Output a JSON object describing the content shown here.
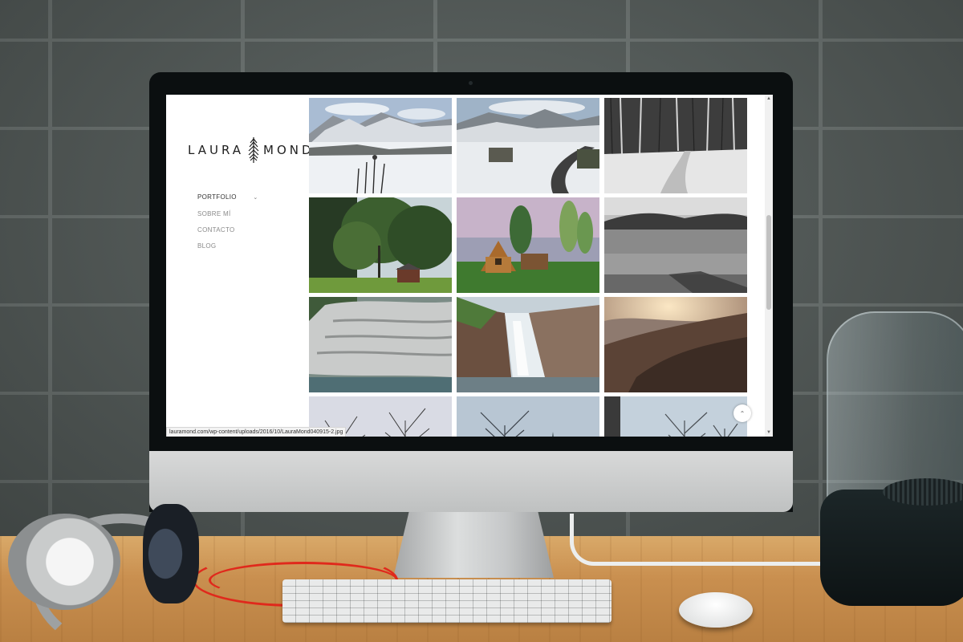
{
  "site": {
    "logo_left": "LAURA",
    "logo_right": "MOND",
    "nav": [
      {
        "label": "PORTFOLIO",
        "active": true,
        "has_submenu": true
      },
      {
        "label": "SOBRE MÍ",
        "active": false
      },
      {
        "label": "CONTACTO",
        "active": false
      },
      {
        "label": "BLOG",
        "active": false
      }
    ]
  },
  "gallery": {
    "photos": [
      {
        "scene": "snowy-mountain-valley"
      },
      {
        "scene": "snowy-mountain-road"
      },
      {
        "scene": "snowy-forest-path"
      },
      {
        "scene": "forest-with-cabin"
      },
      {
        "scene": "wooden-a-frame-cabin"
      },
      {
        "scene": "lake-with-wooden-pier"
      },
      {
        "scene": "rocky-river-gorge"
      },
      {
        "scene": "waterfall-on-cliffs"
      },
      {
        "scene": "sunset-over-rocky-hills"
      },
      {
        "scene": "bare-winter-trees"
      },
      {
        "scene": "misty-tree"
      },
      {
        "scene": "foggy-forest"
      }
    ]
  },
  "browser": {
    "status_url": "lauramond.com/wp-content/uploads/2016/10/LauraMond040915-2.jpg",
    "back_to_top_icon": "chevron-up-icon"
  },
  "colors": {
    "page_bg": "#ffffff",
    "logo_text": "#1e1e1e",
    "nav_active": "#333333",
    "nav_inactive": "#8a8a8a"
  }
}
